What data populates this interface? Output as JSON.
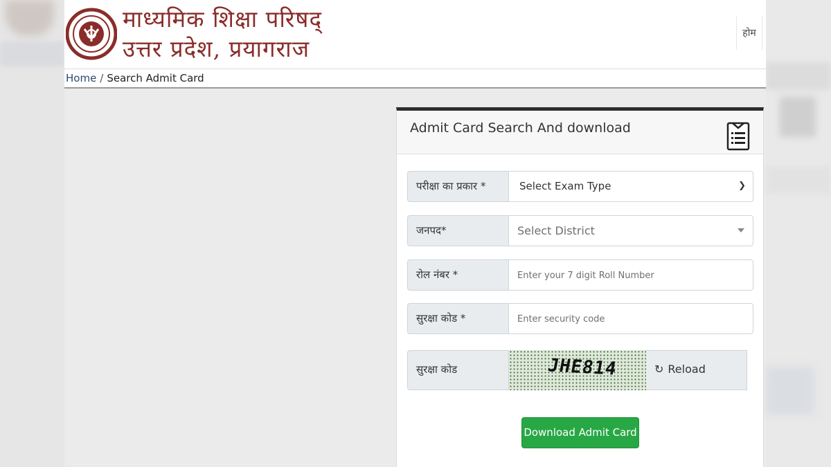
{
  "header": {
    "title_line1": "माध्यमिक शिक्षा परिषद्",
    "title_line2": "उत्तर प्रदेश, प्रयागराज",
    "home_link": "होम"
  },
  "breadcrumb": {
    "home": "Home",
    "separator": "/",
    "current": "Search Admit Card"
  },
  "card": {
    "title": "Admit Card Search And download",
    "icon": "document-list-icon"
  },
  "form": {
    "exam_type": {
      "label": "परीक्षा का प्रकार *",
      "selected": "Select Exam Type"
    },
    "district": {
      "label": "जनपद*",
      "selected": "Select District"
    },
    "roll_number": {
      "label": "रोल नंबर *",
      "placeholder": "Enter your 7 digit Roll Number"
    },
    "security_code": {
      "label": "सुरक्षा कोड *",
      "placeholder": "Enter security code"
    },
    "captcha": {
      "label": "सुरक्षा कोड",
      "code": "JHE814",
      "reload_label": "Reload"
    },
    "submit_label": "Download Admit Card"
  },
  "colors": {
    "title_maroon": "#8a2d2a",
    "button_green": "#28a745",
    "breadcrumb_link": "#2b4a6d"
  }
}
